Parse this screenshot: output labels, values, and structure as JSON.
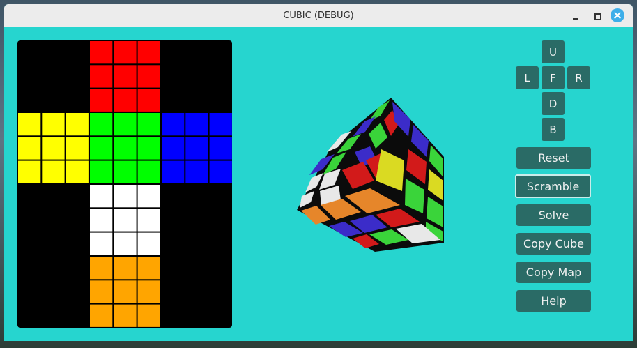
{
  "window": {
    "title": "CUBIC (DEBUG)"
  },
  "titlebar_buttons": [
    "minimize-icon",
    "maximize-icon",
    "close-icon"
  ],
  "colors": {
    "background": "#26d5cf",
    "button": "#2a6b66",
    "red": "#ff0000",
    "green": "#00ff00",
    "blue": "#0000ff",
    "yellow": "#ffff00",
    "white": "#ffffff",
    "orange": "#ffa500"
  },
  "net": {
    "top": "red",
    "left": "yellow",
    "front": "green",
    "right": "blue",
    "down": "white",
    "back": "orange"
  },
  "controls": {
    "moves": {
      "U": "U",
      "L": "L",
      "F": "F",
      "R": "R",
      "D": "D",
      "B": "B"
    },
    "reset": "Reset",
    "scramble": "Scramble",
    "solve": "Solve",
    "copy_cube": "Copy Cube",
    "copy_map": "Copy Map",
    "help": "Help"
  }
}
